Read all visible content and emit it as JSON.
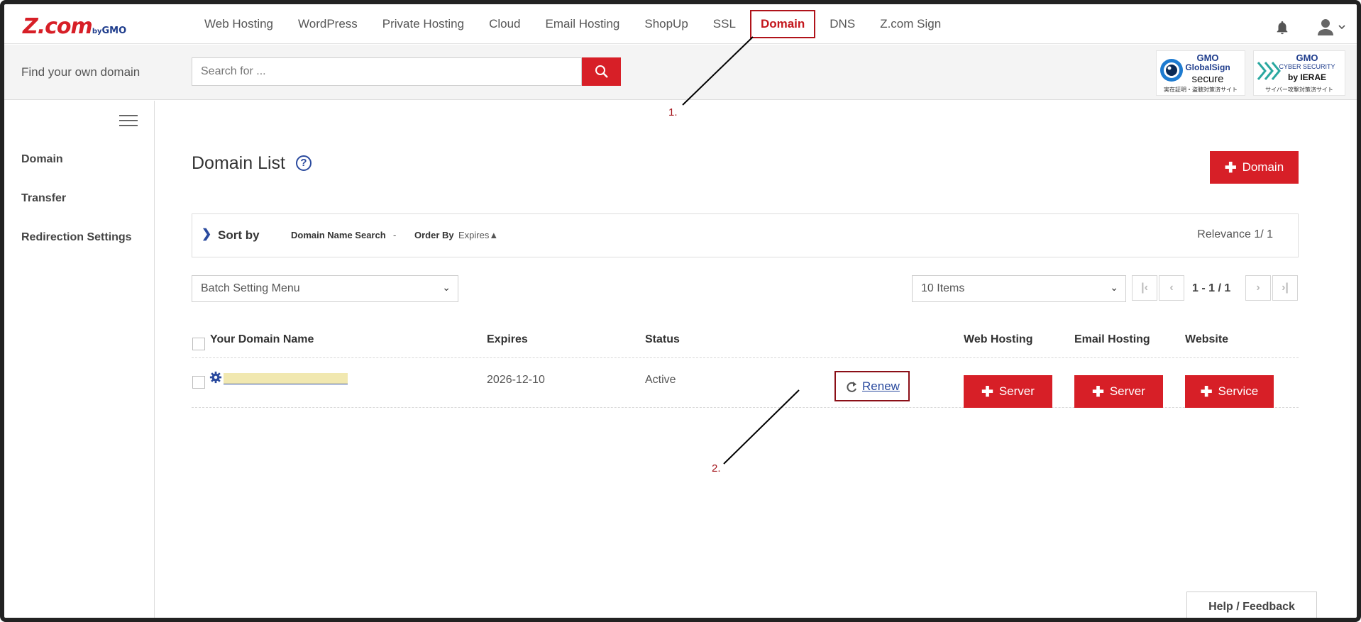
{
  "brand": {
    "logo": "Z.com",
    "by": "by",
    "gmo": "GMO"
  },
  "nav": {
    "items": [
      "Web Hosting",
      "WordPress",
      "Private Hosting",
      "Cloud",
      "Email Hosting",
      "ShopUp",
      "SSL",
      "Domain",
      "DNS",
      "Z.com Sign"
    ],
    "active": "Domain"
  },
  "search": {
    "label": "Find your own domain",
    "placeholder": "Search for ..."
  },
  "badges": {
    "globalsign": {
      "brand": "GMO",
      "line1": "GlobalSign",
      "line2": "secure",
      "small": "実在証明・盗聴対策済サイト"
    },
    "ierae": {
      "brand": "GMO",
      "line1": "CYBER SECURITY",
      "line2": "by IERAE",
      "small": "サイバー攻撃対策済サイト"
    }
  },
  "sidebar": {
    "items": [
      "Domain",
      "Transfer",
      "Redirection Settings"
    ]
  },
  "main": {
    "title": "Domain List",
    "help_icon": "?",
    "add_button": "Domain",
    "sort": {
      "label": "Sort by",
      "filter1_label": "Domain Name Search",
      "filter1_value": "-",
      "filter2_label": "Order By",
      "filter2_value": "Expires▲",
      "relevance": "Relevance 1/ 1"
    },
    "batch_menu": "Batch Setting Menu",
    "items_per_page": "10 Items",
    "pagination": {
      "first": "|‹",
      "prev": "‹",
      "range": "1 - 1 / 1",
      "next": "›",
      "last": "›|"
    },
    "table": {
      "headers": [
        "Your Domain Name",
        "Expires",
        "Status",
        "Web Hosting",
        "Email Hosting",
        "Website"
      ],
      "rows": [
        {
          "expires": "2026-12-10",
          "status": "Active",
          "renew": "Renew",
          "web_hosting": "Server",
          "email_hosting": "Server",
          "website": "Service"
        }
      ]
    }
  },
  "annotations": [
    "1.",
    "2."
  ],
  "help_feedback": "Help / Feedback",
  "colors": {
    "accent": "#d71f27",
    "link": "#2a4a9e",
    "annotation": "#a3141b"
  }
}
